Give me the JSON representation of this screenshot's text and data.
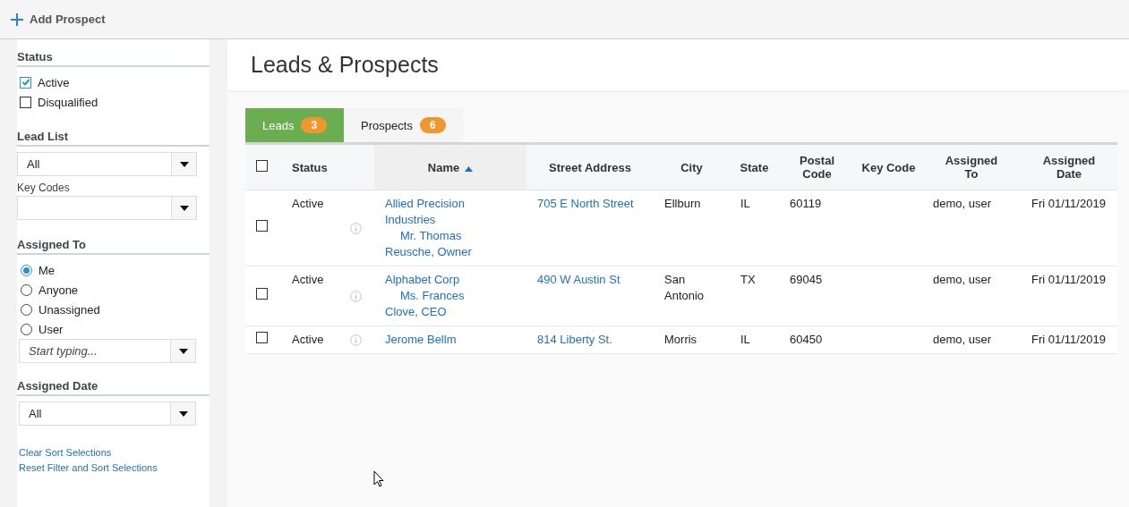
{
  "toolbar": {
    "add_button": "Add Prospect"
  },
  "filters": {
    "status": {
      "title": "Status",
      "options": [
        {
          "label": "Active",
          "checked": true
        },
        {
          "label": "Disqualified",
          "checked": false
        }
      ]
    },
    "lead_list": {
      "title": "Lead List",
      "value": "All"
    },
    "key_codes": {
      "label": "Key Codes"
    },
    "assigned_to": {
      "title": "Assigned To",
      "options": [
        {
          "label": "Me",
          "selected": true
        },
        {
          "label": "Anyone",
          "selected": false
        },
        {
          "label": "Unassigned",
          "selected": false
        },
        {
          "label": "User",
          "selected": false
        }
      ],
      "placeholder": "Start typing..."
    },
    "assigned_date": {
      "title": "Assigned Date",
      "value": "All"
    },
    "links": [
      "Clear Sort Selections",
      "Reset Filter and Sort Selections"
    ]
  },
  "page_title": "Leads & Prospects",
  "tabs": [
    {
      "label": "Leads",
      "count": "3",
      "selected": true
    },
    {
      "label": "Prospects",
      "count": "6",
      "selected": false
    }
  ],
  "table": {
    "select_all": false,
    "columns": [
      {
        "label": "Status",
        "sorted": false
      },
      {
        "label": "Name",
        "sorted": true
      },
      {
        "label": "Street Address",
        "sorted": false
      },
      {
        "label": "City",
        "sorted": false
      },
      {
        "label": "State",
        "sorted": false
      },
      {
        "label": "Postal Code",
        "sorted": false
      },
      {
        "label": "Key Code",
        "sorted": false
      },
      {
        "label": "Assigned To",
        "sorted": false
      },
      {
        "label": "Assigned Date",
        "sorted": false
      }
    ],
    "rows": [
      {
        "checked": false,
        "status": "Active",
        "name": "Allied Precision Industries",
        "contact": "Mr. Thomas Reusche, Owner",
        "street": "705 E North Street",
        "city": "Ellburn",
        "state": "IL",
        "postal": "60119",
        "assigned_to": "demo, user",
        "assigned_date": "Fri 01/11/2019"
      },
      {
        "checked": false,
        "status": "Active",
        "name": "Alphabet Corp",
        "contact": "Ms. Frances Clove, CEO",
        "street": "490 W Austin St",
        "city": "San Antonio",
        "state": "TX",
        "postal": "69045",
        "assigned_to": "demo, user",
        "assigned_date": "Fri 01/11/2019"
      },
      {
        "checked": false,
        "status": "Active",
        "name": "Jerome Bellm",
        "street": "814 Liberty St.",
        "city": "Morris",
        "state": "IL",
        "postal": "60450",
        "assigned_to": "demo, user",
        "assigned_date": "Fri 01/11/2019"
      }
    ]
  }
}
